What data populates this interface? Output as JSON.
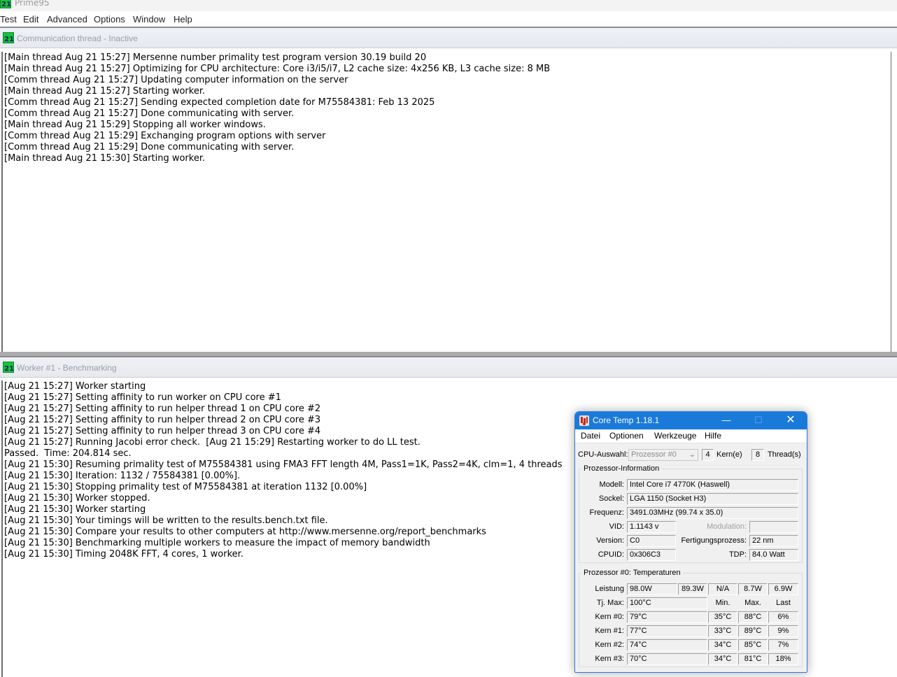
{
  "app": {
    "title": "Prime95",
    "menu": [
      "Test",
      "Edit",
      "Advanced",
      "Options",
      "Window",
      "Help"
    ]
  },
  "comm_window": {
    "title": "Communication thread - Inactive",
    "lines": [
      "[Main thread Aug 21 15:27] Mersenne number primality test program version 30.19 build 20",
      "[Main thread Aug 21 15:27] Optimizing for CPU architecture: Core i3/i5/i7, L2 cache size: 4x256 KB, L3 cache size: 8 MB",
      "[Comm thread Aug 21 15:27] Updating computer information on the server",
      "[Main thread Aug 21 15:27] Starting worker.",
      "[Comm thread Aug 21 15:27] Sending expected completion date for M75584381: Feb 13 2025",
      "[Comm thread Aug 21 15:27] Done communicating with server.",
      "[Main thread Aug 21 15:29] Stopping all worker windows.",
      "[Comm thread Aug 21 15:29] Exchanging program options with server",
      "[Comm thread Aug 21 15:29] Done communicating with server.",
      "[Main thread Aug 21 15:30] Starting worker."
    ]
  },
  "worker_window": {
    "title": "Worker #1 - Benchmarking",
    "lines": [
      "[Aug 21 15:27] Worker starting",
      "[Aug 21 15:27] Setting affinity to run worker on CPU core #1",
      "[Aug 21 15:27] Setting affinity to run helper thread 1 on CPU core #2",
      "[Aug 21 15:27] Setting affinity to run helper thread 2 on CPU core #3",
      "[Aug 21 15:27] Setting affinity to run helper thread 3 on CPU core #4",
      "[Aug 21 15:27] Running Jacobi error check.  [Aug 21 15:29] Restarting worker to do LL test.",
      "Passed.  Time: 204.814 sec.",
      "[Aug 21 15:30] Resuming primality test of M75584381 using FMA3 FFT length 4M, Pass1=1K, Pass2=4K, clm=1, 4 threads",
      "[Aug 21 15:30] Iteration: 1132 / 75584381 [0.00%].",
      "[Aug 21 15:30] Stopping primality test of M75584381 at iteration 1132 [0.00%]",
      "[Aug 21 15:30] Worker stopped.",
      "[Aug 21 15:30] Worker starting",
      "[Aug 21 15:30] Your timings will be written to the results.bench.txt file.",
      "[Aug 21 15:30] Compare your results to other computers at http://www.mersenne.org/report_benchmarks",
      "[Aug 21 15:30] Benchmarking multiple workers to measure the impact of memory bandwidth",
      "[Aug 21 15:30] Timing 2048K FFT, 4 cores, 1 worker."
    ]
  },
  "coretemp": {
    "title": "Core Temp 1.18.1",
    "menu": [
      "Datei",
      "Optionen",
      "Werkzeuge",
      "Hilfe"
    ],
    "cpu_select_label": "CPU-Auswahl:",
    "cpu_select_value": "Prozessor #0",
    "cores_value": "4",
    "cores_label": "Kern(e)",
    "threads_value": "8",
    "threads_label": "Thread(s)",
    "info_group_title": "Prozessor-Information",
    "model_label": "Modell:",
    "model_value": "Intel Core i7 4770K (Haswell)",
    "socket_label": "Sockel:",
    "socket_value": "LGA 1150 (Socket H3)",
    "freq_label": "Frequenz:",
    "freq_value": "3491.03MHz (99.74 x 35.0)",
    "vid_label": "VID:",
    "vid_value": "1.1143 v",
    "modulation_label": "Modulation:",
    "modulation_value": "",
    "version_label": "Version:",
    "version_value": "C0",
    "process_label": "Fertigungsprozess:",
    "process_value": "22 nm",
    "cpuid_label": "CPUID:",
    "cpuid_value": "0x306C3",
    "tdp_label": "TDP:",
    "tdp_value": "84.0 Watt",
    "temp_group_title": "Prozessor #0: Temperaturen",
    "power_label": "Leistung",
    "power_values": [
      "98.0W",
      "89.3W",
      "N/A",
      "8.7W",
      "6.9W"
    ],
    "tjmax_label": "Tj. Max:",
    "tjmax_value": "100°C",
    "col_min": "Min.",
    "col_max": "Max.",
    "col_last": "Last",
    "cores": [
      {
        "label": "Kern #0:",
        "temp": "79°C",
        "min": "35°C",
        "max": "88°C",
        "load": "6%"
      },
      {
        "label": "Kern #1:",
        "temp": "77°C",
        "min": "33°C",
        "max": "89°C",
        "load": "9%"
      },
      {
        "label": "Kern #2:",
        "temp": "74°C",
        "min": "34°C",
        "max": "85°C",
        "load": "7%"
      },
      {
        "label": "Kern #3:",
        "temp": "70°C",
        "min": "34°C",
        "max": "81°C",
        "load": "18%"
      }
    ]
  }
}
